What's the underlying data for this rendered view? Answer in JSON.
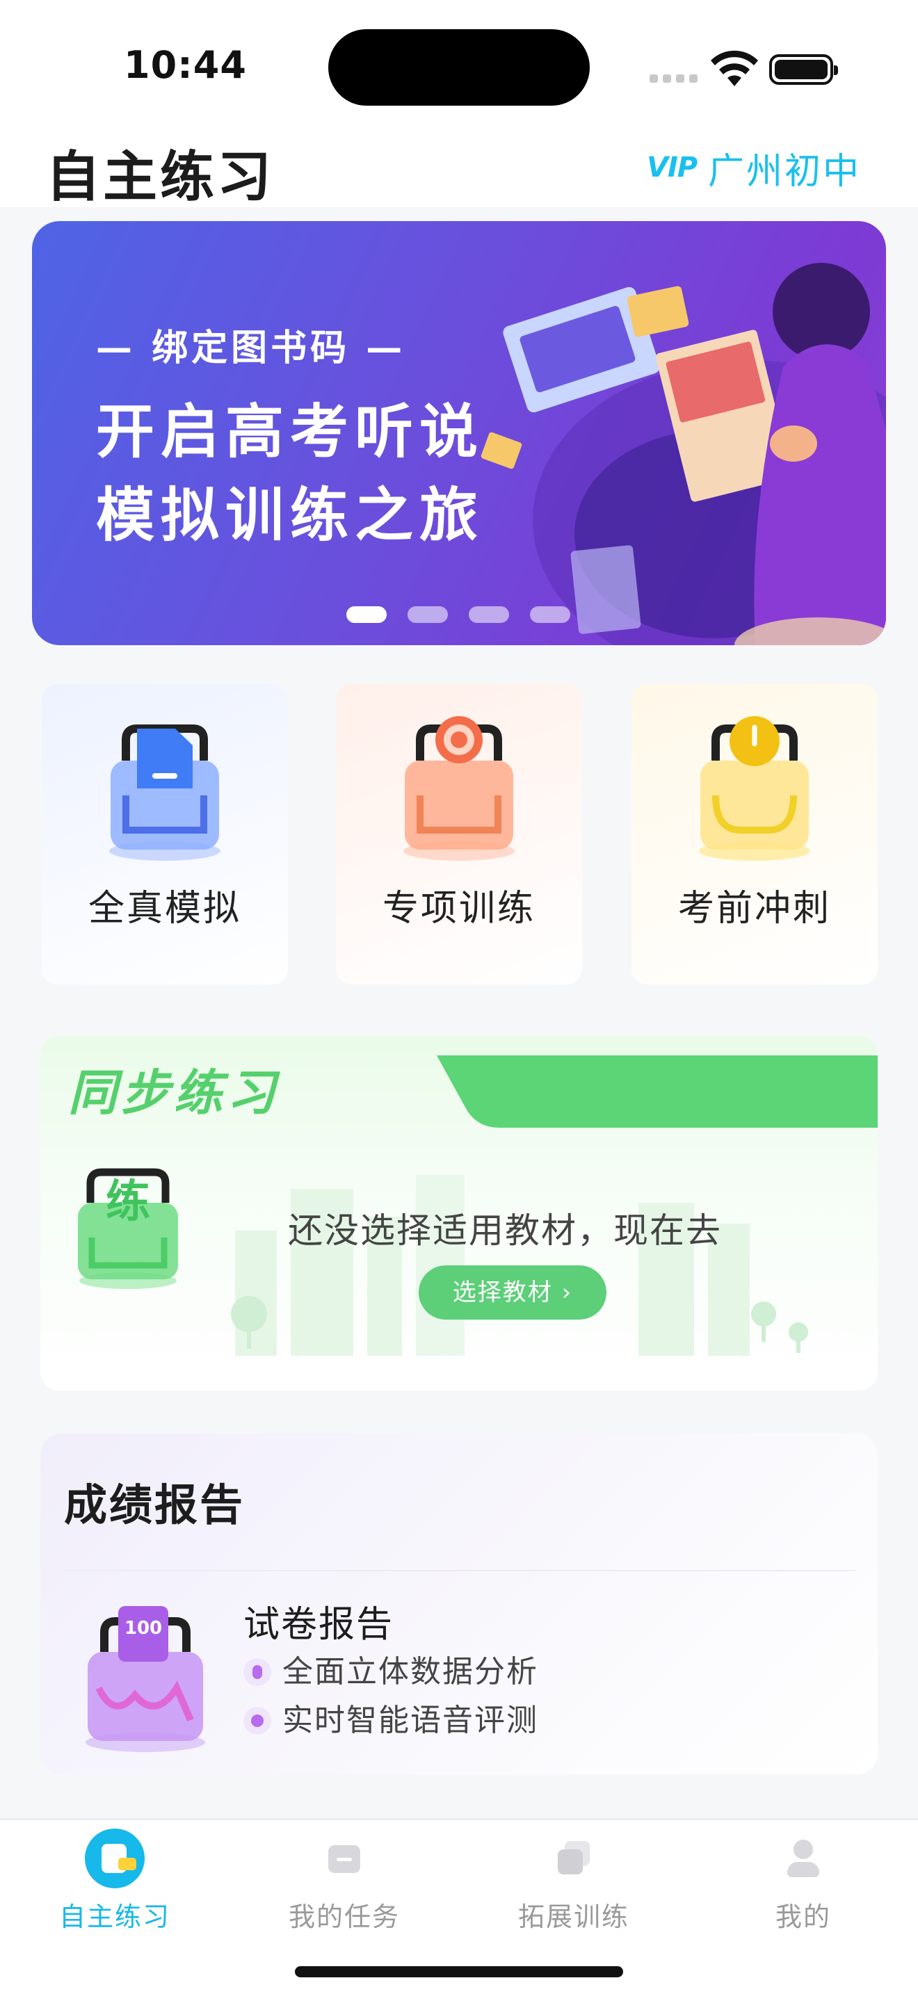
{
  "status_bar": {
    "time": "10:44"
  },
  "header": {
    "title": "自主练习",
    "vip": "VIP",
    "region": "广州初中"
  },
  "banner": {
    "kicker": "— 绑定图书码 —",
    "line1": "开启高考听说",
    "line2": "模拟训练之旅",
    "page_count": 4,
    "active_page": 1
  },
  "features": [
    {
      "label": "全真模拟",
      "icon": "document-bag-icon",
      "color": "#5a8cf5"
    },
    {
      "label": "专项训练",
      "icon": "target-bag-icon",
      "color": "#f47a55"
    },
    {
      "label": "考前冲刺",
      "icon": "stopwatch-bag-icon",
      "color": "#f2c318"
    }
  ],
  "sync": {
    "title": "同步练习",
    "icon_char": "练",
    "message": "还没选择适用教材，现在去",
    "button": "选择教材 ›"
  },
  "report": {
    "title": "成绩报告",
    "icon_text": "100",
    "subtitle": "试卷报告",
    "line1": "全面立体数据分析",
    "line2": "实时智能语音评测"
  },
  "tabbar": [
    {
      "label": "自主练习",
      "icon": "practice-icon",
      "active": true
    },
    {
      "label": "我的任务",
      "icon": "task-icon",
      "active": false
    },
    {
      "label": "拓展训练",
      "icon": "expand-icon",
      "active": false
    },
    {
      "label": "我的",
      "icon": "profile-icon",
      "active": false
    }
  ],
  "colors": {
    "accent": "#17b8ea",
    "green": "#5ccf78",
    "purple": "#b76bee"
  }
}
